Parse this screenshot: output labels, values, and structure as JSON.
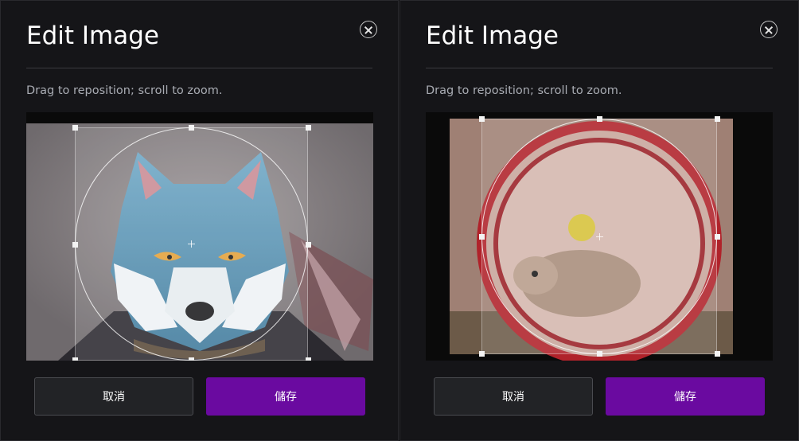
{
  "dialogs": [
    {
      "title": "Edit Image",
      "hint": "Drag to reposition; scroll to zoom.",
      "cancel_label": "取消",
      "save_label": "儲存",
      "image_subject": "wolf-portrait"
    },
    {
      "title": "Edit Image",
      "hint": "Drag to reposition; scroll to zoom.",
      "cancel_label": "取消",
      "save_label": "儲存",
      "image_subject": "hamster-wheel"
    }
  ],
  "colors": {
    "background": "#151518",
    "save_button": "#6a0aa0",
    "cancel_button": "#222326",
    "title_text": "#ffffff",
    "hint_text": "#a9acb3"
  },
  "icons": {
    "close": "close-icon",
    "crosshair": "crosshair-icon"
  }
}
